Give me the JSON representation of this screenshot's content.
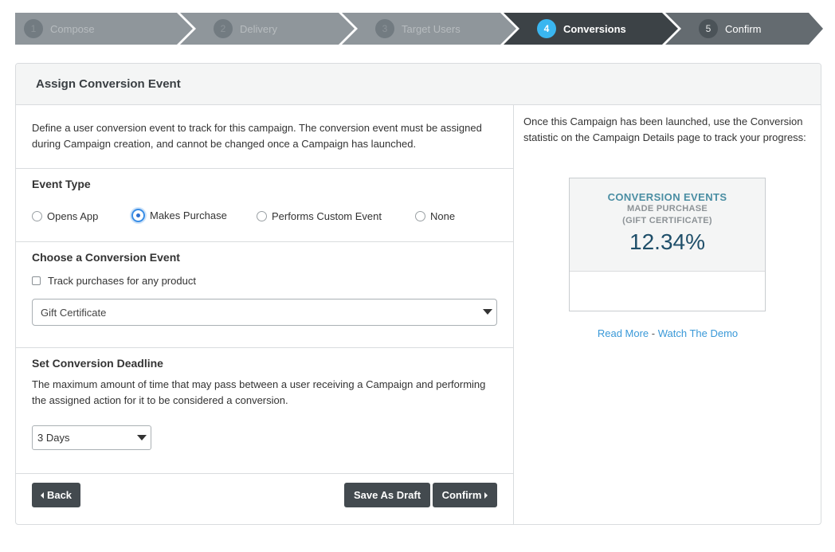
{
  "wizard": {
    "steps": [
      {
        "number": "1",
        "label": "Compose",
        "state": "done"
      },
      {
        "number": "2",
        "label": "Delivery",
        "state": "done"
      },
      {
        "number": "3",
        "label": "Target Users",
        "state": "done"
      },
      {
        "number": "4",
        "label": "Conversions",
        "state": "active"
      },
      {
        "number": "5",
        "label": "Confirm",
        "state": "future"
      }
    ],
    "check_icon": "✔",
    "colors": {
      "done": "#8f969b",
      "active": "#3c4246",
      "future": "#646b70",
      "active_badge": "#3ab6f0"
    }
  },
  "panel": {
    "title": "Assign Conversion Event",
    "intro": "Define a user conversion event to track for this campaign. The conversion event must be assigned during Campaign creation, and cannot be changed once a Campaign has launched.",
    "event_type": {
      "heading": "Event Type",
      "options": [
        "Opens App",
        "Makes Purchase",
        "Performs Custom Event",
        "None"
      ],
      "selected": "Makes Purchase"
    },
    "conversion_event": {
      "heading": "Choose a Conversion Event",
      "checkbox_label": "Track purchases for any product",
      "checkbox_checked": false,
      "select_value": "Gift Certificate"
    },
    "deadline": {
      "heading": "Set Conversion Deadline",
      "description": "The maximum amount of time that may pass between a user receiving a Campaign and performing the assigned action for it to be considered a conversion.",
      "select_value": "3 Days"
    },
    "buttons": {
      "back": "Back",
      "save_draft": "Save As Draft",
      "confirm": "Confirm"
    }
  },
  "sidebar": {
    "info": "Once this Campaign has been launched, use the Conversion statistic on the Campaign Details page to track your progress:",
    "stat": {
      "title": "CONVERSION EVENTS",
      "subtitle_1": "MADE PURCHASE",
      "subtitle_2": "(GIFT CERTIFICATE)",
      "value": "12.34%"
    },
    "links": {
      "read_more": "Read More",
      "separator": " - ",
      "watch_demo": "Watch The Demo"
    }
  }
}
